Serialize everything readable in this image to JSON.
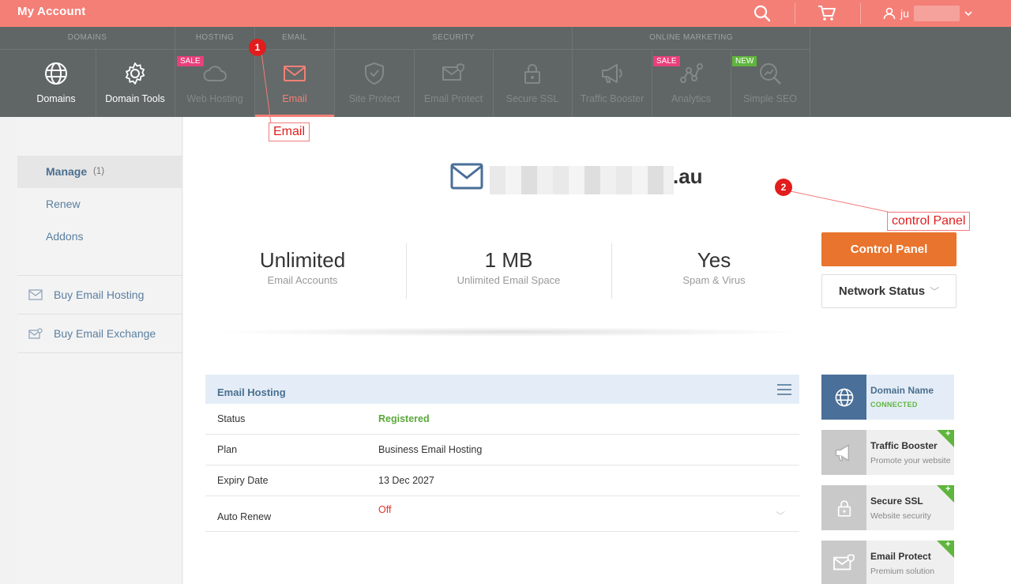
{
  "app": {
    "title": "My Account",
    "user_name": "ju"
  },
  "topbar": {
    "icons": [
      "search-icon",
      "cart-icon",
      "user-icon",
      "chevron-down-icon"
    ]
  },
  "nav": {
    "groups": [
      {
        "label": "DOMAINS"
      },
      {
        "label": "HOSTING"
      },
      {
        "label": "EMAIL"
      },
      {
        "label": "SECURITY"
      },
      {
        "label": "ONLINE MARKETING"
      }
    ],
    "items": [
      {
        "label": "Domains",
        "icon": "globe-icon"
      },
      {
        "label": "Domain Tools",
        "icon": "gear-icon"
      },
      {
        "label": "Web Hosting",
        "icon": "cloud-icon",
        "badge": "SALE"
      },
      {
        "label": "Email",
        "icon": "envelope-icon"
      },
      {
        "label": "Site Protect",
        "icon": "shield-icon"
      },
      {
        "label": "Email Protect",
        "icon": "envelope-shield-icon"
      },
      {
        "label": "Secure SSL",
        "icon": "lock-icon"
      },
      {
        "label": "Traffic Booster",
        "icon": "megaphone-icon"
      },
      {
        "label": "Analytics",
        "icon": "analytics-icon",
        "badge": "SALE"
      },
      {
        "label": "Simple SEO",
        "icon": "seo-search-icon",
        "badge": "NEW"
      }
    ]
  },
  "sidebar": {
    "manage_label": "Manage",
    "manage_count": "(1)",
    "links": [
      "Renew",
      "Addons"
    ],
    "buy": [
      {
        "label": "Buy Email Hosting",
        "icon": "envelope-icon"
      },
      {
        "label": "Buy Email Exchange",
        "icon": "envelope-exchange-icon"
      }
    ]
  },
  "main": {
    "domain_suffix": ".au",
    "stats": [
      {
        "value": "Unlimited",
        "label": "Email Accounts"
      },
      {
        "value": "1 MB",
        "label": "Unlimited Email Space"
      },
      {
        "value": "Yes",
        "label": "Spam & Virus"
      }
    ],
    "control_panel_label": "Control Panel",
    "network_status_label": "Network Status"
  },
  "panel": {
    "title": "Email Hosting",
    "rows": [
      {
        "key": "Status",
        "value": "Registered"
      },
      {
        "key": "Plan",
        "value": "Business Email Hosting"
      },
      {
        "key": "Expiry Date",
        "value": "13 Dec 2027"
      },
      {
        "key": "Auto Renew",
        "value": "Off"
      }
    ]
  },
  "cards": [
    {
      "title": "Domain Name",
      "subtitle": "CONNECTED",
      "icon": "globe-icon"
    },
    {
      "title": "Traffic Booster",
      "subtitle": "Promote your website",
      "icon": "megaphone-icon"
    },
    {
      "title": "Secure SSL",
      "subtitle": "Website security",
      "icon": "lock-icon"
    },
    {
      "title": "Email Protect",
      "subtitle": "Premium solution",
      "icon": "envelope-shield-icon"
    }
  ],
  "annotations": [
    {
      "number": "1",
      "label": "Email"
    },
    {
      "number": "2",
      "label": "control Panel"
    }
  ],
  "colors": {
    "accent": "#f47f77",
    "nav_bg": "#5f6665",
    "button_orange": "#e8742d",
    "status_green": "#5aa83a",
    "off_red": "#e5332a"
  }
}
